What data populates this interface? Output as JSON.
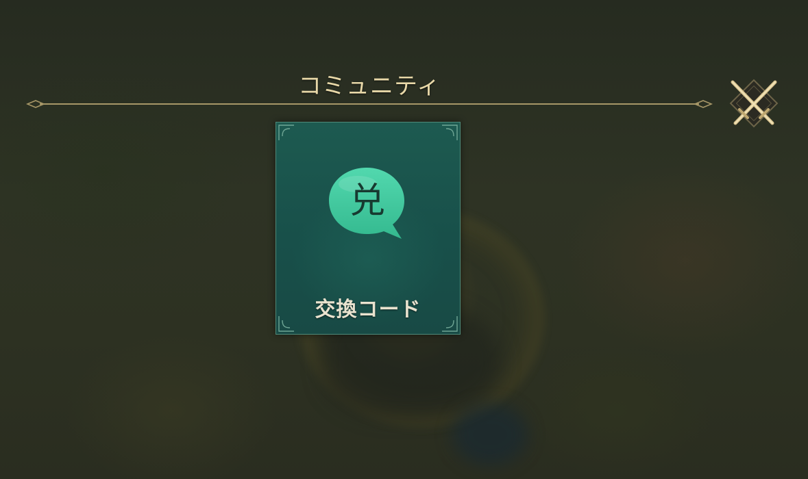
{
  "header": {
    "title": "コミュニティ"
  },
  "close_button": {
    "icon": "crossed-swords-icon"
  },
  "cards": [
    {
      "icon": "speech-bubble-icon",
      "icon_glyph": "兑",
      "label": "交換コード"
    }
  ],
  "colors": {
    "title": "#e8d8a8",
    "rule": "#a89868",
    "card_background": "#1a554c",
    "card_border": "#4f8a79",
    "bubble": "#3fc79f",
    "label": "#e9e3cf"
  }
}
